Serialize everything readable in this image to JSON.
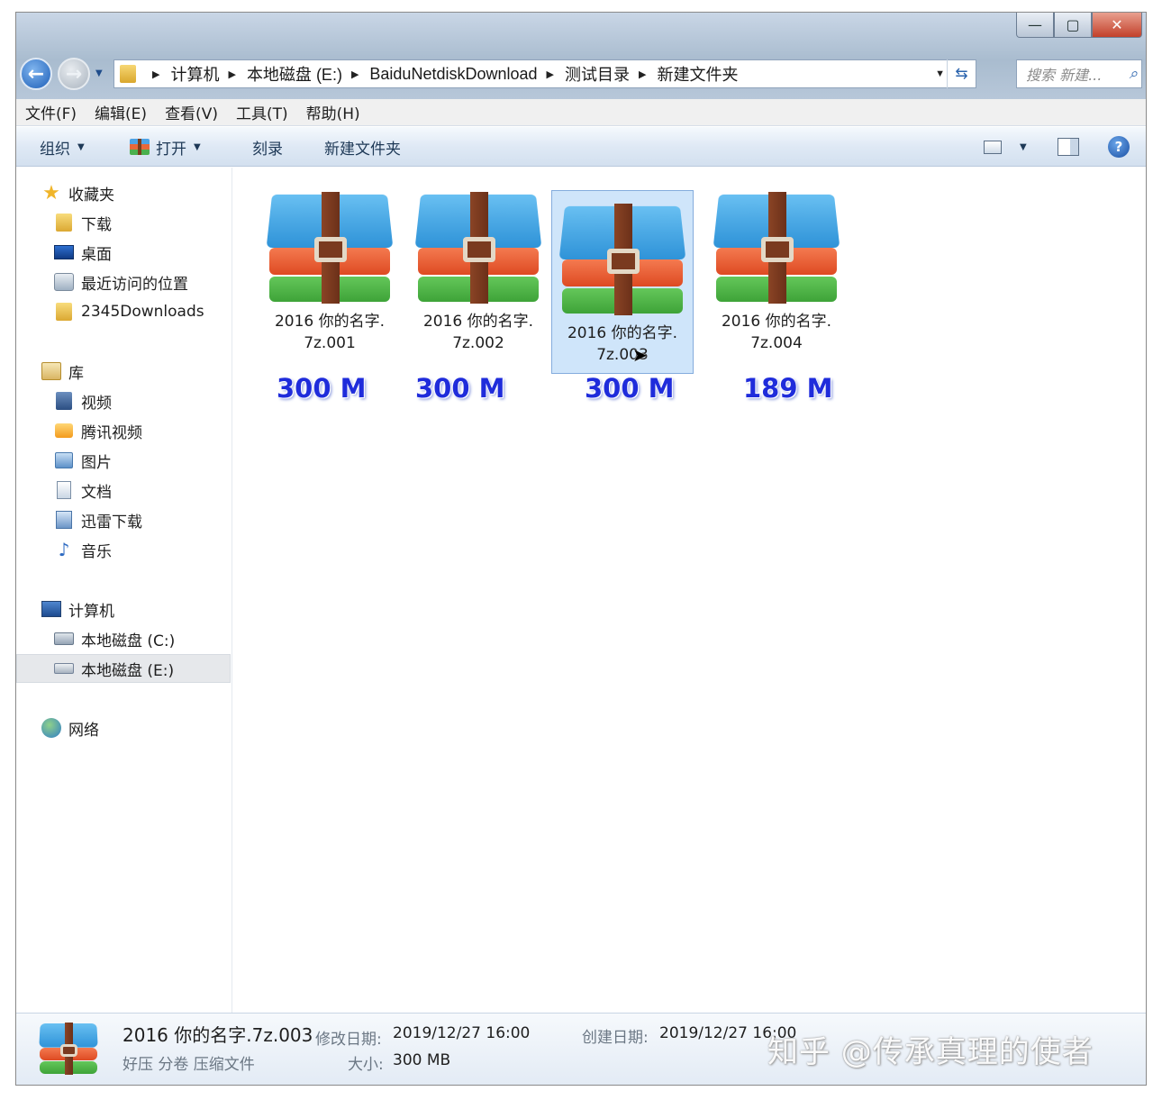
{
  "window": {
    "caption_min": "—",
    "caption_max": "▢",
    "caption_close": "✕"
  },
  "address_bar": {
    "crumbs": [
      "计算机",
      "本地磁盘 (E:)",
      "BaiduNetdiskDownload",
      "测试目录",
      "新建文件夹"
    ]
  },
  "search": {
    "placeholder": "搜索 新建..."
  },
  "menu": [
    "文件(F)",
    "编辑(E)",
    "查看(V)",
    "工具(T)",
    "帮助(H)"
  ],
  "command_bar": {
    "organize": "组织",
    "open": "打开",
    "burn": "刻录",
    "new_folder": "新建文件夹",
    "help": "?"
  },
  "nav_pane": {
    "favorites": "收藏夹",
    "downloads": "下载",
    "desktop": "桌面",
    "recent": "最近访问的位置",
    "downloads_2345": "2345Downloads",
    "libraries": "库",
    "videos": "视频",
    "tencent_video": "腾讯视频",
    "pictures": "图片",
    "documents": "文档",
    "thunder": "迅雷下载",
    "music": "音乐",
    "computer": "计算机",
    "drive_c": "本地磁盘 (C:)",
    "drive_e": "本地磁盘 (E:)",
    "network": "网络"
  },
  "files": [
    {
      "line1": "2016 你的名字.",
      "line2": "7z.001",
      "size_annotation": "300 M"
    },
    {
      "line1": "2016 你的名字.",
      "line2": "7z.002",
      "size_annotation": "300 M"
    },
    {
      "line1": "2016 你的名字.",
      "line2": "7z.003",
      "size_annotation": "300 M",
      "selected": true
    },
    {
      "line1": "2016 你的名字.",
      "line2": "7z.004",
      "size_annotation": "189 M"
    }
  ],
  "details": {
    "filename": "2016 你的名字.7z.003",
    "type": "好压 分卷 压缩文件",
    "modified_label": "修改日期:",
    "modified_value": "2019/12/27 16:00",
    "created_label": "创建日期:",
    "created_value": "2019/12/27 16:00",
    "size_label": "大小:",
    "size_value": "300 MB"
  },
  "watermark": "知乎 @传承真理的使者",
  "colors": {
    "size_annotation": "#1f2cdb",
    "selection_bg": "#cfe5fa",
    "selection_border": "#84acdd"
  }
}
